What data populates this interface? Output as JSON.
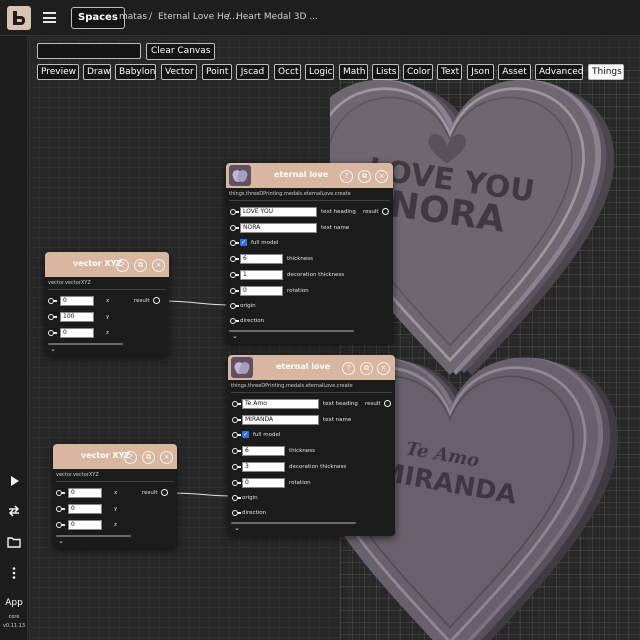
{
  "header": {
    "spaces_label": "Spaces",
    "breadcrumbs": [
      "matas",
      "/",
      "Eternal Love He...",
      "/",
      "Heart Medal 3D ..."
    ]
  },
  "toolbar": {
    "search_value": "",
    "clear_label": "Clear Canvas",
    "tabs": [
      "Preview",
      "Draw",
      "Babylon",
      "Vector",
      "Point",
      "Jscad",
      "Occt",
      "Logic",
      "Math",
      "Lists",
      "Color",
      "Text",
      "Json",
      "Asset",
      "Advanced",
      "Things"
    ],
    "active_tab": "Things"
  },
  "sidebar": {
    "app_label": "App",
    "core_label": "core",
    "version": "v0.11.13",
    "icons": [
      "play-icon",
      "swap-icon",
      "folder-icon",
      "more-vertical-icon"
    ]
  },
  "scene": {
    "heart_top": {
      "line1": "LOVE YOU",
      "line2": "NORA"
    },
    "heart_bottom": {
      "line1": "Te Amo",
      "line2": "MIRANDA"
    }
  },
  "nodes": {
    "vector1": {
      "title": "vector XYZ",
      "path": "vector.vectorXYZ",
      "inputs": [
        {
          "value": "0",
          "label": "x"
        },
        {
          "value": "100",
          "label": "y"
        },
        {
          "value": "0",
          "label": "z"
        }
      ],
      "output_label": "result"
    },
    "vector2": {
      "title": "vector XYZ",
      "path": "vector.vectorXYZ",
      "inputs": [
        {
          "value": "0",
          "label": "x"
        },
        {
          "value": "0",
          "label": "y"
        },
        {
          "value": "0",
          "label": "z"
        }
      ],
      "output_label": "result"
    },
    "love1": {
      "title": "eternal love",
      "path": "things.threeDPrinting.medals.eternalLove.create",
      "text_heading": {
        "value": "LOVE YOU",
        "label": "text heading"
      },
      "text_name": {
        "value": "NORA",
        "label": "text name"
      },
      "full_model": {
        "label": "full model",
        "checked": true
      },
      "thickness": {
        "value": "6",
        "label": "thickness"
      },
      "decoration_thickness": {
        "value": "1",
        "label": "decoration thickness"
      },
      "rotation": {
        "value": "0",
        "label": "rotation"
      },
      "origin_label": "origin",
      "direction_label": "direction",
      "output_label": "result"
    },
    "love2": {
      "title": "eternal love",
      "path": "things.threeDPrinting.medals.eternalLove.create",
      "text_heading": {
        "value": "Te Amo",
        "label": "text heading"
      },
      "text_name": {
        "value": "MIRANDA",
        "label": "text name"
      },
      "full_model": {
        "label": "full model",
        "checked": true
      },
      "thickness": {
        "value": "6",
        "label": "thickness"
      },
      "decoration_thickness": {
        "value": "3",
        "label": "decoration thickness"
      },
      "rotation": {
        "value": "0",
        "label": "rotation"
      },
      "origin_label": "origin",
      "direction_label": "direction",
      "output_label": "result"
    }
  },
  "colors": {
    "node_header": "#d9b6a0",
    "checkbox": "#2f6fe0",
    "heart": "#6e6770"
  }
}
